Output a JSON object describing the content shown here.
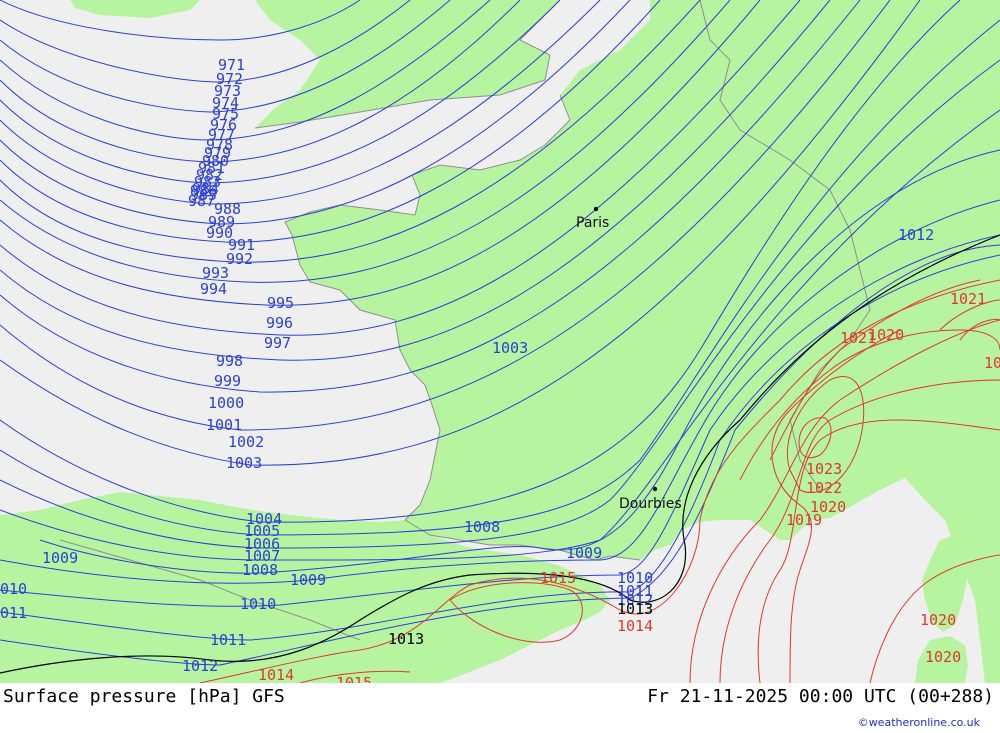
{
  "map": {
    "colors": {
      "sea": "#efefef",
      "land": "#b7f4a0",
      "isobar_low": "#2b3fd8",
      "isobar_high": "#e0392b",
      "isobar_ref": "#000000",
      "coast": "#8f8f8f"
    },
    "cities": [
      {
        "name": "Paris"
      },
      {
        "name": "Dourbies"
      }
    ],
    "labels": [
      {
        "text": "971",
        "cls": "blue"
      },
      {
        "text": "972",
        "cls": "blue"
      },
      {
        "text": "973",
        "cls": "blue"
      },
      {
        "text": "974",
        "cls": "blue"
      },
      {
        "text": "975",
        "cls": "blue"
      },
      {
        "text": "976",
        "cls": "blue"
      },
      {
        "text": "977",
        "cls": "blue"
      },
      {
        "text": "978",
        "cls": "blue"
      },
      {
        "text": "979",
        "cls": "blue"
      },
      {
        "text": "980",
        "cls": "blue"
      },
      {
        "text": "981",
        "cls": "blue"
      },
      {
        "text": "982",
        "cls": "blue"
      },
      {
        "text": "983",
        "cls": "blue"
      },
      {
        "text": "984",
        "cls": "blue"
      },
      {
        "text": "985",
        "cls": "blue"
      },
      {
        "text": "986",
        "cls": "blue"
      },
      {
        "text": "987",
        "cls": "blue"
      },
      {
        "text": "988",
        "cls": "blue"
      },
      {
        "text": "989",
        "cls": "blue"
      },
      {
        "text": "990",
        "cls": "blue"
      },
      {
        "text": "991",
        "cls": "blue"
      },
      {
        "text": "992",
        "cls": "blue"
      },
      {
        "text": "993",
        "cls": "blue"
      },
      {
        "text": "994",
        "cls": "blue"
      },
      {
        "text": "995",
        "cls": "blue"
      },
      {
        "text": "996",
        "cls": "blue"
      },
      {
        "text": "997",
        "cls": "blue"
      },
      {
        "text": "998",
        "cls": "blue"
      },
      {
        "text": "999",
        "cls": "blue"
      },
      {
        "text": "1000",
        "cls": "blue"
      },
      {
        "text": "1001",
        "cls": "blue"
      },
      {
        "text": "1002",
        "cls": "blue"
      },
      {
        "text": "1003",
        "cls": "blue"
      },
      {
        "text": "1003",
        "cls": "blue"
      },
      {
        "text": "1004",
        "cls": "blue"
      },
      {
        "text": "1005",
        "cls": "blue"
      },
      {
        "text": "1006",
        "cls": "blue"
      },
      {
        "text": "1007",
        "cls": "blue"
      },
      {
        "text": "1008",
        "cls": "blue"
      },
      {
        "text": "1008",
        "cls": "blue"
      },
      {
        "text": "1009",
        "cls": "blue"
      },
      {
        "text": "1009",
        "cls": "blue"
      },
      {
        "text": "1009",
        "cls": "blue"
      },
      {
        "text": "1010",
        "cls": "blue"
      },
      {
        "text": "1010",
        "cls": "blue"
      },
      {
        "text": "010",
        "cls": "blue"
      },
      {
        "text": "011",
        "cls": "blue"
      },
      {
        "text": "1011",
        "cls": "blue"
      },
      {
        "text": "1011",
        "cls": "blue"
      },
      {
        "text": "1012",
        "cls": "blue"
      },
      {
        "text": "1012",
        "cls": "blue"
      },
      {
        "text": "1012",
        "cls": "blue"
      },
      {
        "text": "1013",
        "cls": "black"
      },
      {
        "text": "1013",
        "cls": "black"
      },
      {
        "text": "1014",
        "cls": "red"
      },
      {
        "text": "1014",
        "cls": "red"
      },
      {
        "text": "1015",
        "cls": "red"
      },
      {
        "text": "1015",
        "cls": "red"
      },
      {
        "text": "1019",
        "cls": "red"
      },
      {
        "text": "1020",
        "cls": "red"
      },
      {
        "text": "1020",
        "cls": "red"
      },
      {
        "text": "1020",
        "cls": "red"
      },
      {
        "text": "1021",
        "cls": "red"
      },
      {
        "text": "1021",
        "cls": "red"
      },
      {
        "text": "1022",
        "cls": "red"
      },
      {
        "text": "1023",
        "cls": "red"
      },
      {
        "text": "1020",
        "cls": "red"
      },
      {
        "text": "10",
        "cls": "red"
      }
    ]
  },
  "footer": {
    "product": "Surface pressure [hPa] GFS",
    "valid": "Fr 21-11-2025 00:00 UTC (00+288)",
    "credit": "©weatheronline.co.uk"
  }
}
